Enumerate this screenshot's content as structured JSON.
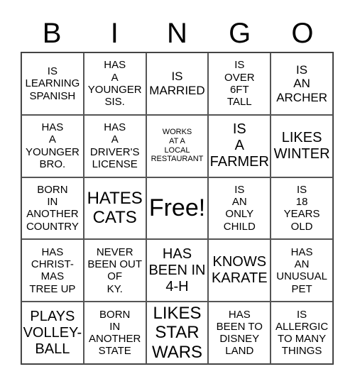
{
  "header": [
    "B",
    "I",
    "N",
    "G",
    "O"
  ],
  "cells": [
    "IS\nLEARNING\nSPANISH",
    "HAS\nA\nYOUNGER\nSIS.",
    "IS\nMARRIED",
    "IS\nOVER\n6FT\nTALL",
    "IS\nAN\nARCHER",
    "HAS\nA\nYOUNGER\nBRO.",
    "HAS\nA\nDRIVER'S\nLICENSE",
    "WORKS\nAT A\nLOCAL\nRESTAURANT",
    "IS\nA\nFARMER",
    "LIKES\nWINTER",
    "BORN\nIN\nANOTHER\nCOUNTRY",
    "HATES\nCATS",
    "Free!",
    "IS\nAN\nONLY\nCHILD",
    "IS\n18\nYEARS\nOLD",
    "HAS\nCHRIST-\nMAS\nTREE UP",
    "NEVER\nBEEN OUT\nOF\nKY.",
    "HAS\nBEEN IN\n4-H",
    "KNOWS\nKARATE",
    "HAS\nAN\nUNUSUAL\nPET",
    "PLAYS\nVOLLEY-\nBALL",
    "BORN\nIN\nANOTHER\nSTATE",
    "LIKES\nSTAR\nWARS",
    "HAS\nBEEN TO\nDISNEY\nLAND",
    "IS\nALLERGIC\nTO MANY\nTHINGS"
  ]
}
